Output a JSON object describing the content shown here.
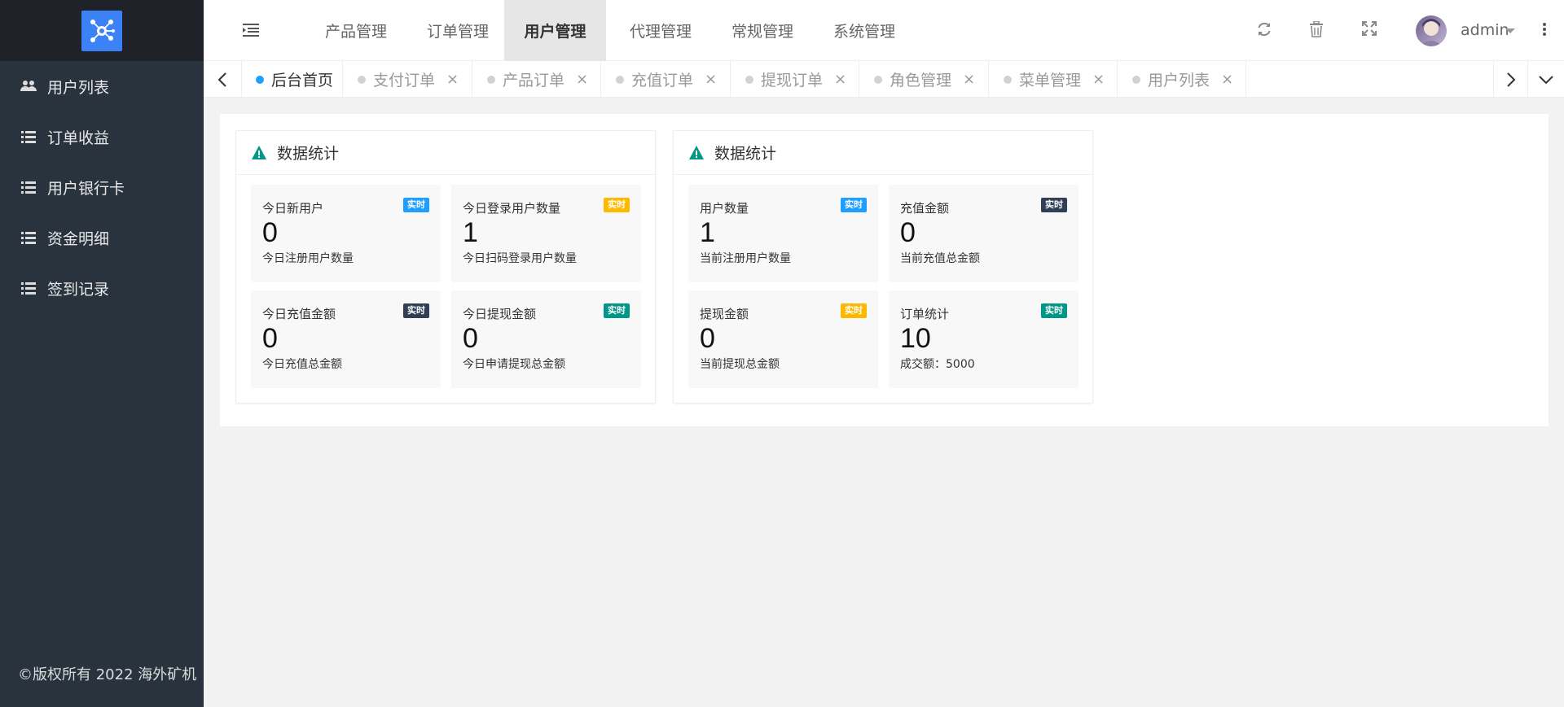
{
  "sidebar": {
    "items": [
      {
        "label": "用户列表",
        "icon": "users-icon"
      },
      {
        "label": "订单收益",
        "icon": "list-icon"
      },
      {
        "label": "用户银行卡",
        "icon": "list-icon"
      },
      {
        "label": "资金明细",
        "icon": "list-icon"
      },
      {
        "label": "签到记录",
        "icon": "list-icon"
      }
    ],
    "copyright": "©版权所有 2022 海外矿机"
  },
  "header": {
    "nav": [
      "产品管理",
      "订单管理",
      "用户管理",
      "代理管理",
      "常规管理",
      "系统管理"
    ],
    "active_nav": "用户管理",
    "username": "admin"
  },
  "tabs": [
    {
      "label": "后台首页",
      "active": true,
      "closable": false
    },
    {
      "label": "支付订单",
      "active": false,
      "closable": true
    },
    {
      "label": "产品订单",
      "active": false,
      "closable": true
    },
    {
      "label": "充值订单",
      "active": false,
      "closable": true
    },
    {
      "label": "提现订单",
      "active": false,
      "closable": true
    },
    {
      "label": "角色管理",
      "active": false,
      "closable": true
    },
    {
      "label": "菜单管理",
      "active": false,
      "closable": true
    },
    {
      "label": "用户列表",
      "active": false,
      "closable": true
    }
  ],
  "close_glyph": "×",
  "cards": [
    {
      "title": "数据统计",
      "stats": [
        {
          "label": "今日新用户",
          "badge": "实时",
          "badge_color": "#1e9fff",
          "value": "0",
          "sub": "今日注册用户数量"
        },
        {
          "label": "今日登录用户数量",
          "badge": "实时",
          "badge_color": "#ffb800",
          "value": "1",
          "sub": "今日扫码登录用户数量"
        },
        {
          "label": "今日充值金额",
          "badge": "实时",
          "badge_color": "#2f4056",
          "value": "0",
          "sub": "今日充值总金额"
        },
        {
          "label": "今日提现金额",
          "badge": "实时",
          "badge_color": "#009688",
          "value": "0",
          "sub": "今日申请提现总金额"
        }
      ]
    },
    {
      "title": "数据统计",
      "stats": [
        {
          "label": "用户数量",
          "badge": "实时",
          "badge_color": "#1e9fff",
          "value": "1",
          "sub": "当前注册用户数量"
        },
        {
          "label": "充值金额",
          "badge": "实时",
          "badge_color": "#2f4056",
          "value": "0",
          "sub": "当前充值总金额"
        },
        {
          "label": "提现金额",
          "badge": "实时",
          "badge_color": "#ffb800",
          "value": "0",
          "sub": "当前提现总金额"
        },
        {
          "label": "订单统计",
          "badge": "实时",
          "badge_color": "#009688",
          "value": "10",
          "sub": "成交额：5000"
        }
      ]
    }
  ],
  "colors": {
    "sidebar_bg": "#28333e",
    "logo_bg": "#20222a",
    "accent": "#1e9fff",
    "warn_icon": "#009688"
  }
}
